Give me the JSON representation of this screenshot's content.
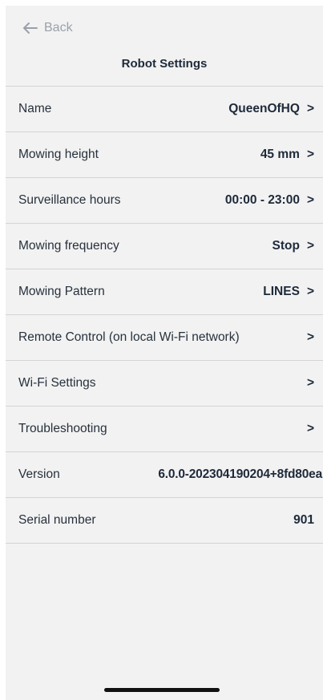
{
  "header": {
    "back_label": "Back",
    "title": "Robot Settings"
  },
  "rows": [
    {
      "label": "Name",
      "value": "QueenOfHQ",
      "chevron": ">"
    },
    {
      "label": "Mowing height",
      "value": "45 mm",
      "chevron": ">"
    },
    {
      "label": "Surveillance hours",
      "value": "00:00 - 23:00",
      "chevron": ">"
    },
    {
      "label": "Mowing frequency",
      "value": "Stop",
      "chevron": ">"
    },
    {
      "label": "Mowing Pattern",
      "value": "LINES",
      "chevron": ">"
    },
    {
      "label": "Remote Control (on local Wi-Fi network)",
      "chevron": ">"
    },
    {
      "label": "Wi-Fi Settings",
      "chevron": ">"
    },
    {
      "label": "Troubleshooting",
      "chevron": ">"
    },
    {
      "label": "Version",
      "value": "6.0.0-202304190204+8fd80ea"
    },
    {
      "label": "Serial number",
      "value": "901"
    }
  ],
  "icons": {
    "back": "arrow-left-icon"
  },
  "colors": {
    "background": "#f2f2f2",
    "text": "#1e2a3a",
    "muted": "#9aa1ab",
    "divider": "#d4d4d4"
  }
}
